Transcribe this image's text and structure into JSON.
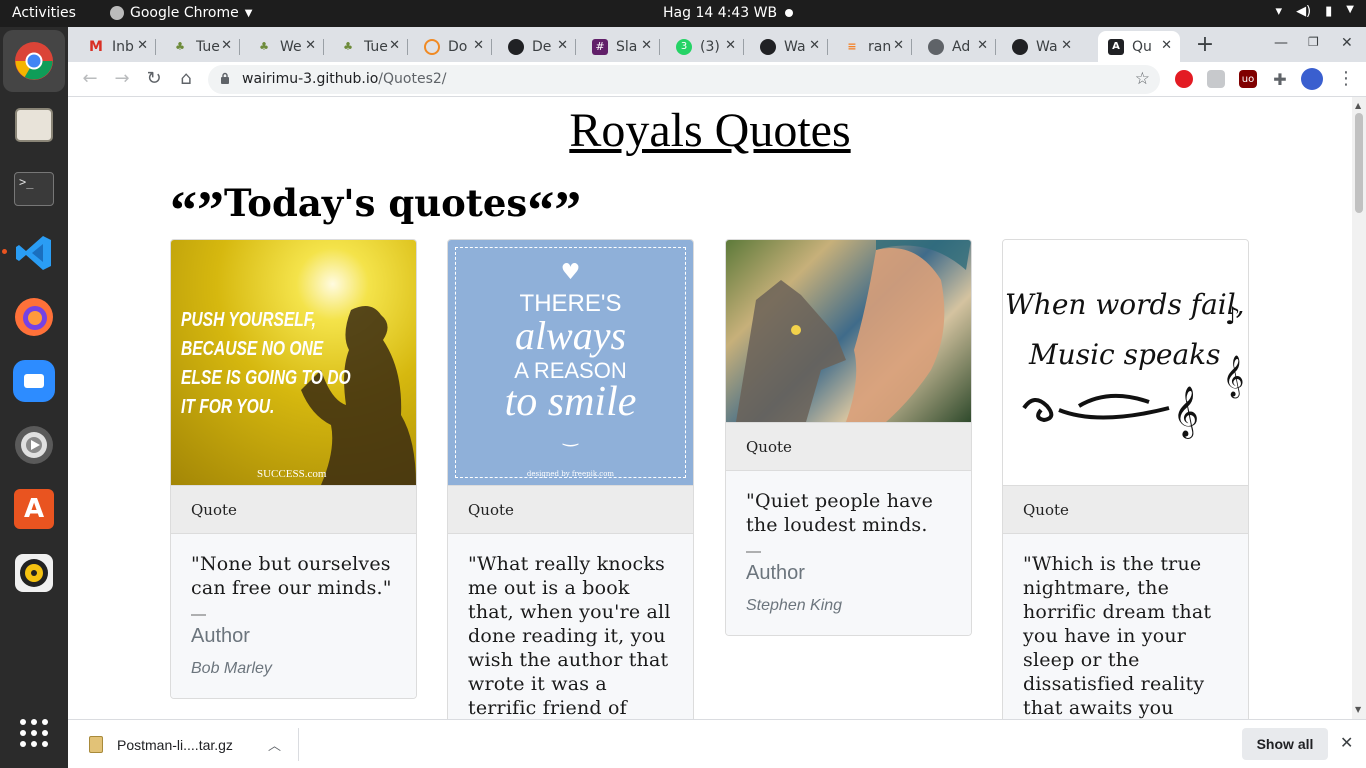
{
  "os": {
    "activities": "Activities",
    "app_menu": "Google Chrome",
    "clock": "Hag 14  4:43 WB"
  },
  "browser": {
    "tabs": [
      {
        "title": "Inb",
        "icon": "gmail-icon",
        "color": "#d93025"
      },
      {
        "title": "Tue",
        "icon": "tree-icon",
        "color": "#6d8b3a"
      },
      {
        "title": "We",
        "icon": "tree-icon",
        "color": "#6d8b3a"
      },
      {
        "title": "Tue",
        "icon": "tree-icon",
        "color": "#6d8b3a"
      },
      {
        "title": "Do",
        "icon": "clock-icon",
        "color": "#f08a24"
      },
      {
        "title": "De",
        "icon": "github-icon",
        "color": "#202124"
      },
      {
        "title": "Sla",
        "icon": "slack-icon",
        "color": "#611f69"
      },
      {
        "title": "(3)",
        "icon": "whatsapp-icon",
        "color": "#25d366"
      },
      {
        "title": "Wa",
        "icon": "github-icon",
        "color": "#202124"
      },
      {
        "title": "ran",
        "icon": "stack-icon",
        "color": "#f48024"
      },
      {
        "title": "Ad",
        "icon": "globe-icon",
        "color": "#5f6368"
      },
      {
        "title": "Wa",
        "icon": "github-icon",
        "color": "#202124"
      },
      {
        "title": "Qu",
        "icon": "angular-icon",
        "color": "#202124"
      }
    ],
    "url_host": "wairimu-3.github.io",
    "url_path": "/Quotes2/"
  },
  "page": {
    "site_title": "Royals Quotes",
    "section_title": "Today's quotes",
    "open_quote": "“",
    "close_quote": "”",
    "cards": [
      {
        "header": "Quote",
        "text": "\"None but ourselves can free our minds.\"",
        "dash": "—",
        "author_label": "Author",
        "author": "Bob Marley",
        "image_text": "PUSH YOURSELF, BECAUSE NO ONE ELSE IS GOING TO DO IT FOR YOU.",
        "image_credit": "SUCCESS.com"
      },
      {
        "header": "Quote",
        "text": "\"What really knocks me out is a book that, when you're all done reading it, you wish the author that wrote it was a terrific friend of yours and",
        "image_line1": "THERE'S",
        "image_line2": "always",
        "image_line3": "A REASON",
        "image_line4": "to smile",
        "image_credit": "designed by freepik.com"
      },
      {
        "header": "Quote",
        "text": "\"Quiet people have the loudest minds.",
        "dash": "—",
        "author_label": "Author",
        "author": "Stephen King"
      },
      {
        "header": "Quote",
        "text": "\"Which is the true nightmare, the horrific dream that you have in your sleep or the dissatisfied reality that awaits you when",
        "image_line1": "When words fail,",
        "image_line2": "Music speaks"
      }
    ]
  },
  "downloads": {
    "file_name": "Postman-li....tar.gz",
    "show_all": "Show all"
  }
}
